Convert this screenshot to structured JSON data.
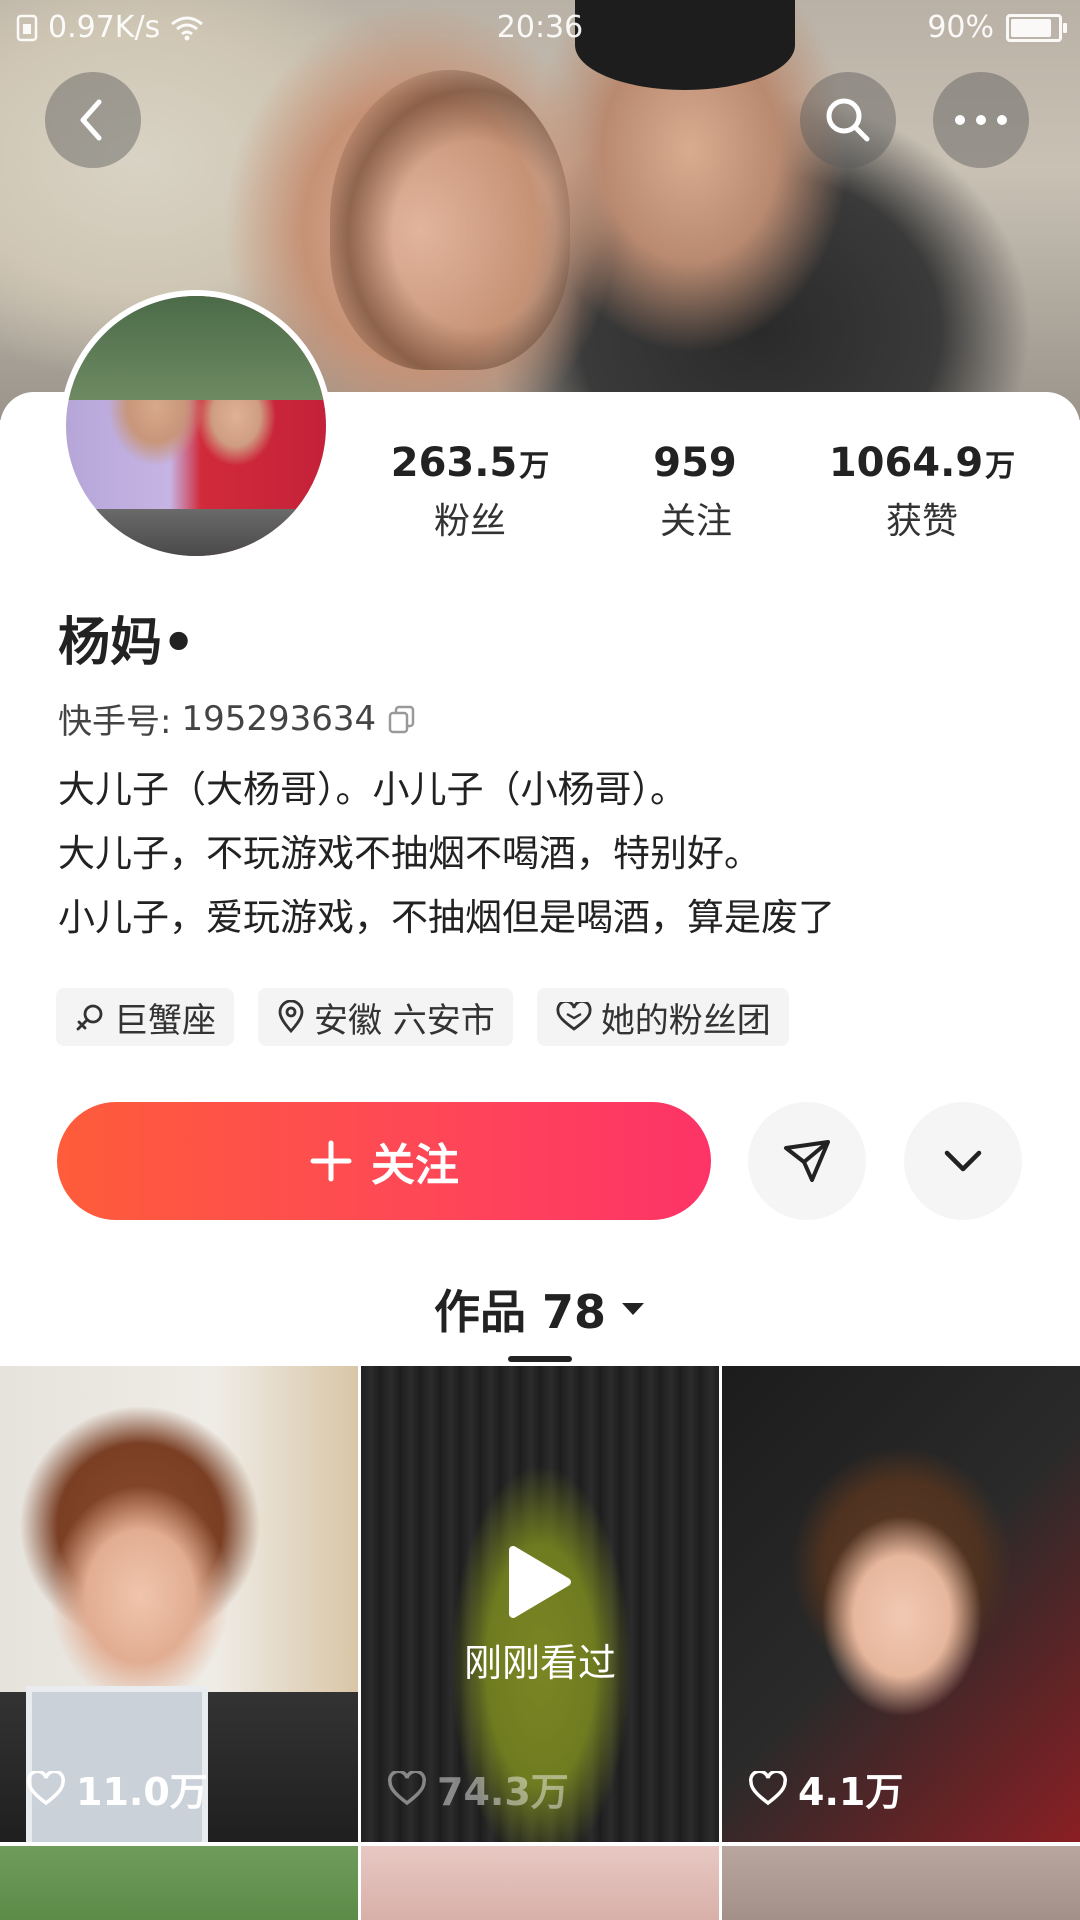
{
  "status_bar": {
    "net_speed": "0.97K/s",
    "time": "20:36",
    "battery": "90%"
  },
  "header": {
    "back_icon": "chevron-left-icon",
    "search_icon": "search-icon",
    "more_icon": "more-horizontal-icon"
  },
  "profile": {
    "name": "杨妈•",
    "kuaishou_id_label": "快手号:",
    "kuaishou_id": "195293634",
    "stats": [
      {
        "value": "263.5",
        "unit": "万",
        "label": "粉丝"
      },
      {
        "value": "959",
        "unit": "",
        "label": "关注"
      },
      {
        "value": "1064.9",
        "unit": "万",
        "label": "获赞"
      }
    ],
    "bio": [
      "大儿子（大杨哥）。小儿子（小杨哥）。",
      "大儿子，不玩游戏不抽烟不喝酒，特别好。",
      "小儿子，爱玩游戏，不抽烟但是喝酒，算是废了"
    ],
    "tags": [
      {
        "icon": "zodiac-icon",
        "label": "巨蟹座"
      },
      {
        "icon": "location-pin-icon",
        "label": "安徽 六安市"
      },
      {
        "icon": "heart-outline-icon",
        "label": "她的粉丝团"
      }
    ]
  },
  "actions": {
    "follow_label": "关注",
    "follow_gradient": [
      "#fe5c3a",
      "#fd3367"
    ],
    "share_icon": "send-icon",
    "expand_icon": "chevron-down-icon"
  },
  "works_tab": {
    "label": "作品 78"
  },
  "videos": [
    {
      "likes": "11.0万"
    },
    {
      "likes": "74.3万",
      "overlay": "刚刚看过"
    },
    {
      "likes": "4.1万"
    }
  ]
}
